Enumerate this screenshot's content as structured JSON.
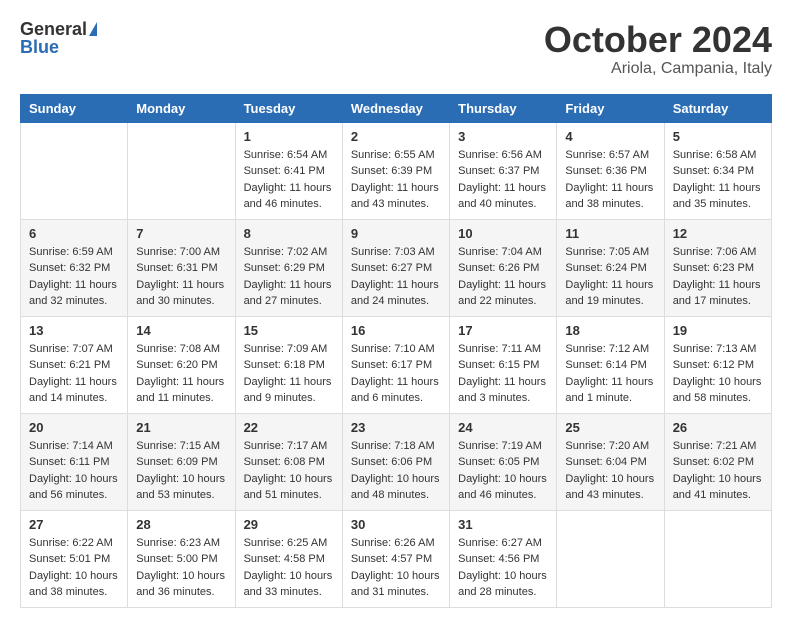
{
  "logo": {
    "general": "General",
    "blue": "Blue"
  },
  "title": "October 2024",
  "location": "Ariola, Campania, Italy",
  "headers": [
    "Sunday",
    "Monday",
    "Tuesday",
    "Wednesday",
    "Thursday",
    "Friday",
    "Saturday"
  ],
  "weeks": [
    [
      {
        "day": "",
        "info": ""
      },
      {
        "day": "",
        "info": ""
      },
      {
        "day": "1",
        "info": "Sunrise: 6:54 AM\nSunset: 6:41 PM\nDaylight: 11 hours and 46 minutes."
      },
      {
        "day": "2",
        "info": "Sunrise: 6:55 AM\nSunset: 6:39 PM\nDaylight: 11 hours and 43 minutes."
      },
      {
        "day": "3",
        "info": "Sunrise: 6:56 AM\nSunset: 6:37 PM\nDaylight: 11 hours and 40 minutes."
      },
      {
        "day": "4",
        "info": "Sunrise: 6:57 AM\nSunset: 6:36 PM\nDaylight: 11 hours and 38 minutes."
      },
      {
        "day": "5",
        "info": "Sunrise: 6:58 AM\nSunset: 6:34 PM\nDaylight: 11 hours and 35 minutes."
      }
    ],
    [
      {
        "day": "6",
        "info": "Sunrise: 6:59 AM\nSunset: 6:32 PM\nDaylight: 11 hours and 32 minutes."
      },
      {
        "day": "7",
        "info": "Sunrise: 7:00 AM\nSunset: 6:31 PM\nDaylight: 11 hours and 30 minutes."
      },
      {
        "day": "8",
        "info": "Sunrise: 7:02 AM\nSunset: 6:29 PM\nDaylight: 11 hours and 27 minutes."
      },
      {
        "day": "9",
        "info": "Sunrise: 7:03 AM\nSunset: 6:27 PM\nDaylight: 11 hours and 24 minutes."
      },
      {
        "day": "10",
        "info": "Sunrise: 7:04 AM\nSunset: 6:26 PM\nDaylight: 11 hours and 22 minutes."
      },
      {
        "day": "11",
        "info": "Sunrise: 7:05 AM\nSunset: 6:24 PM\nDaylight: 11 hours and 19 minutes."
      },
      {
        "day": "12",
        "info": "Sunrise: 7:06 AM\nSunset: 6:23 PM\nDaylight: 11 hours and 17 minutes."
      }
    ],
    [
      {
        "day": "13",
        "info": "Sunrise: 7:07 AM\nSunset: 6:21 PM\nDaylight: 11 hours and 14 minutes."
      },
      {
        "day": "14",
        "info": "Sunrise: 7:08 AM\nSunset: 6:20 PM\nDaylight: 11 hours and 11 minutes."
      },
      {
        "day": "15",
        "info": "Sunrise: 7:09 AM\nSunset: 6:18 PM\nDaylight: 11 hours and 9 minutes."
      },
      {
        "day": "16",
        "info": "Sunrise: 7:10 AM\nSunset: 6:17 PM\nDaylight: 11 hours and 6 minutes."
      },
      {
        "day": "17",
        "info": "Sunrise: 7:11 AM\nSunset: 6:15 PM\nDaylight: 11 hours and 3 minutes."
      },
      {
        "day": "18",
        "info": "Sunrise: 7:12 AM\nSunset: 6:14 PM\nDaylight: 11 hours and 1 minute."
      },
      {
        "day": "19",
        "info": "Sunrise: 7:13 AM\nSunset: 6:12 PM\nDaylight: 10 hours and 58 minutes."
      }
    ],
    [
      {
        "day": "20",
        "info": "Sunrise: 7:14 AM\nSunset: 6:11 PM\nDaylight: 10 hours and 56 minutes."
      },
      {
        "day": "21",
        "info": "Sunrise: 7:15 AM\nSunset: 6:09 PM\nDaylight: 10 hours and 53 minutes."
      },
      {
        "day": "22",
        "info": "Sunrise: 7:17 AM\nSunset: 6:08 PM\nDaylight: 10 hours and 51 minutes."
      },
      {
        "day": "23",
        "info": "Sunrise: 7:18 AM\nSunset: 6:06 PM\nDaylight: 10 hours and 48 minutes."
      },
      {
        "day": "24",
        "info": "Sunrise: 7:19 AM\nSunset: 6:05 PM\nDaylight: 10 hours and 46 minutes."
      },
      {
        "day": "25",
        "info": "Sunrise: 7:20 AM\nSunset: 6:04 PM\nDaylight: 10 hours and 43 minutes."
      },
      {
        "day": "26",
        "info": "Sunrise: 7:21 AM\nSunset: 6:02 PM\nDaylight: 10 hours and 41 minutes."
      }
    ],
    [
      {
        "day": "27",
        "info": "Sunrise: 6:22 AM\nSunset: 5:01 PM\nDaylight: 10 hours and 38 minutes."
      },
      {
        "day": "28",
        "info": "Sunrise: 6:23 AM\nSunset: 5:00 PM\nDaylight: 10 hours and 36 minutes."
      },
      {
        "day": "29",
        "info": "Sunrise: 6:25 AM\nSunset: 4:58 PM\nDaylight: 10 hours and 33 minutes."
      },
      {
        "day": "30",
        "info": "Sunrise: 6:26 AM\nSunset: 4:57 PM\nDaylight: 10 hours and 31 minutes."
      },
      {
        "day": "31",
        "info": "Sunrise: 6:27 AM\nSunset: 4:56 PM\nDaylight: 10 hours and 28 minutes."
      },
      {
        "day": "",
        "info": ""
      },
      {
        "day": "",
        "info": ""
      }
    ]
  ]
}
